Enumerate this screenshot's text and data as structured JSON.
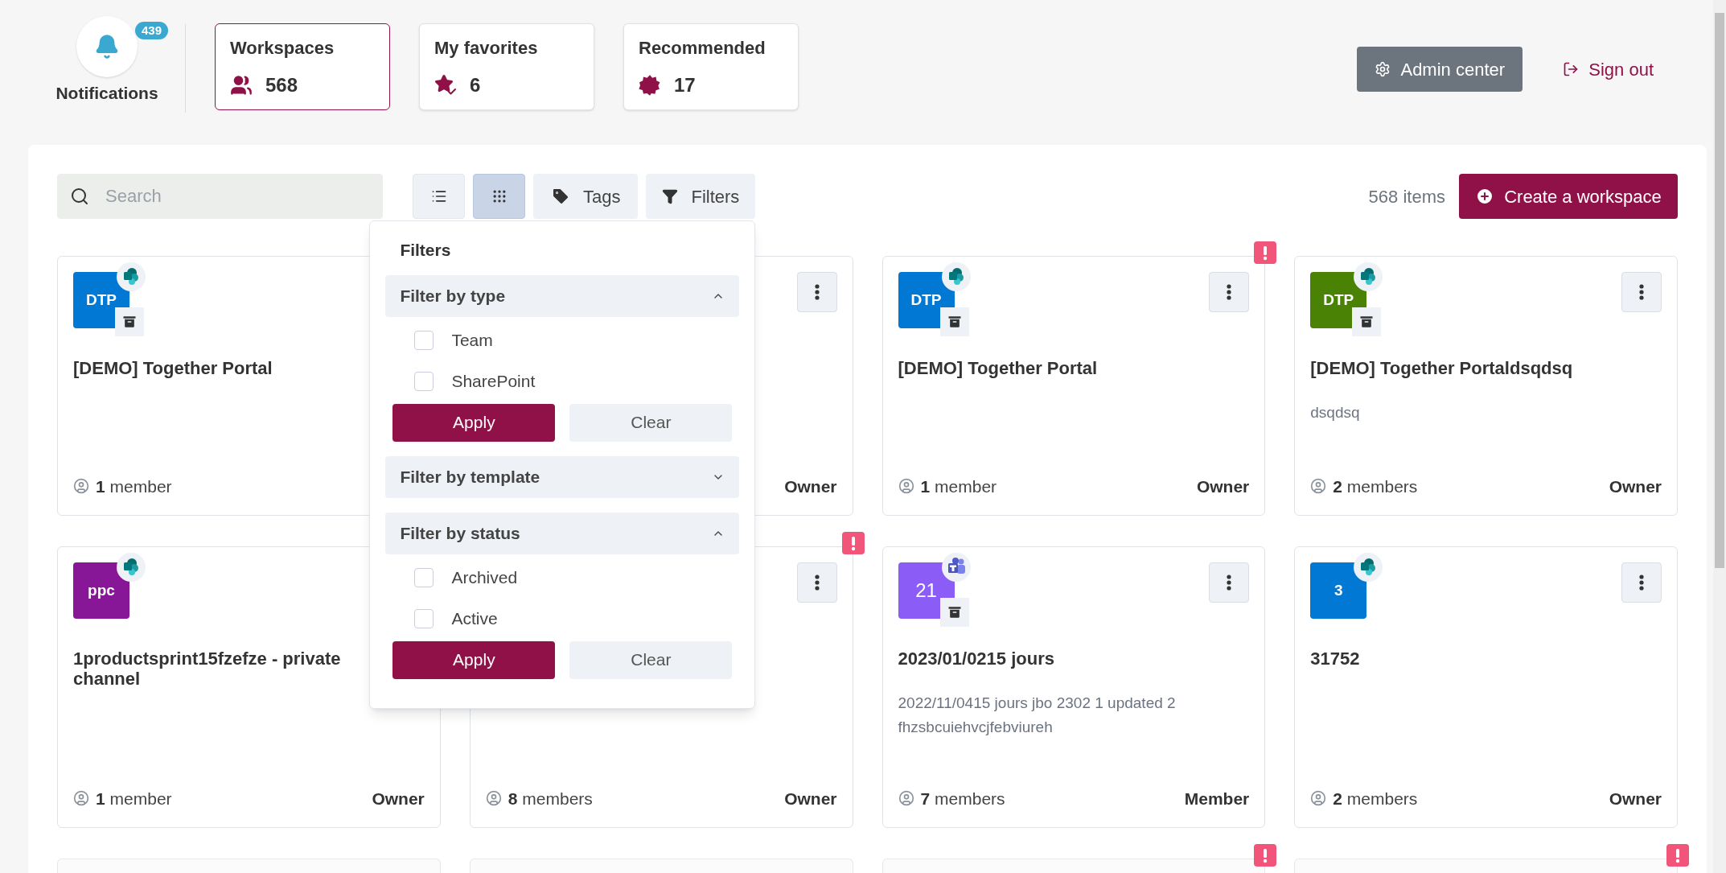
{
  "notifications": {
    "label": "Notifications",
    "count": "439"
  },
  "tabs": [
    {
      "label": "Workspaces",
      "count": "568",
      "kind": "users",
      "selected": true
    },
    {
      "label": "My favorites",
      "count": "6",
      "kind": "favorite",
      "selected": false
    },
    {
      "label": "Recommended",
      "count": "17",
      "kind": "recommended",
      "selected": false
    }
  ],
  "admin_button": "Admin center",
  "sign_out": "Sign out",
  "search": {
    "placeholder": "Search"
  },
  "view_buttons": [
    {
      "kind": "list",
      "selected": false
    },
    {
      "kind": "grid",
      "selected": true
    }
  ],
  "tags_button": "Tags",
  "filters_button": "Filters",
  "item_count": "568 items",
  "create_button": "Create a workspace",
  "filters_panel": {
    "title": "Filters",
    "sections": [
      {
        "title": "Filter by type",
        "expanded": true,
        "options": [
          {
            "label": "Team",
            "checked": false
          },
          {
            "label": "SharePoint",
            "checked": false
          }
        ],
        "apply": "Apply",
        "clear": "Clear"
      },
      {
        "title": "Filter by template",
        "expanded": false
      },
      {
        "title": "Filter by status",
        "expanded": true,
        "options": [
          {
            "label": "Archived",
            "checked": false
          },
          {
            "label": "Active",
            "checked": false
          }
        ],
        "apply": "Apply",
        "clear": "Clear"
      }
    ]
  },
  "cards": [
    {
      "partial": false,
      "avatar": {
        "text": "DTP",
        "color": "#0078d4",
        "bold": true
      },
      "app": {
        "kind": "sharepoint"
      },
      "archived": true,
      "title": "[DEMO] Together Portal",
      "members": {
        "count": "1",
        "label": "member"
      },
      "menu": false
    },
    {
      "partial": false,
      "menu": true,
      "role": "Owner"
    },
    {
      "partial": false,
      "avatar": {
        "text": "DTP",
        "color": "#0078d4",
        "bold": true
      },
      "app": {
        "kind": "sharepoint"
      },
      "archived": true,
      "title": "[DEMO] Together Portal",
      "members": {
        "count": "1",
        "label": "member"
      },
      "role": "Owner",
      "menu": true,
      "alert": true
    },
    {
      "partial": false,
      "avatar": {
        "text": "DTP",
        "color": "#498205",
        "bold": true
      },
      "app": {
        "kind": "sharepoint"
      },
      "archived": true,
      "title": "[DEMO] Together Portaldsqdsq",
      "description": "dsqdsq",
      "members": {
        "count": "2",
        "label": "members"
      },
      "role": "Owner",
      "menu": true
    },
    {
      "partial": false,
      "avatar": {
        "text": "ppc",
        "color": "#881798",
        "bold": true
      },
      "app": {
        "kind": "sharepoint"
      },
      "archived": false,
      "title": "1productsprint15fzefze - private channel",
      "members": {
        "count": "1",
        "label": "member"
      },
      "role": "Owner",
      "menu": false
    },
    {
      "partial": false,
      "menu": true,
      "members": {
        "count": "8",
        "label": "members"
      },
      "role": "Owner",
      "alert": true
    },
    {
      "partial": false,
      "avatar": {
        "text": "21",
        "color": "#8b5cf6",
        "bold": false
      },
      "app": {
        "kind": "teams"
      },
      "archived": true,
      "title": "2023/01/0215 jours",
      "description": "2022/11/0415 jours jbo 2302 1 updated 2 fhzsbcuiehvcjfebviureh",
      "members": {
        "count": "7",
        "label": "members"
      },
      "role": "Member",
      "menu": true
    },
    {
      "partial": false,
      "avatar": {
        "text": "3",
        "color": "#0078d4",
        "bold": true
      },
      "app": {
        "kind": "sharepoint"
      },
      "archived": false,
      "title": "31752",
      "members": {
        "count": "2",
        "label": "members"
      },
      "role": "Owner",
      "menu": true
    },
    {
      "partial": true,
      "alert": false
    },
    {
      "partial": true,
      "alert": false
    },
    {
      "partial": true,
      "alert": true
    },
    {
      "partial": true,
      "alert": true
    }
  ]
}
